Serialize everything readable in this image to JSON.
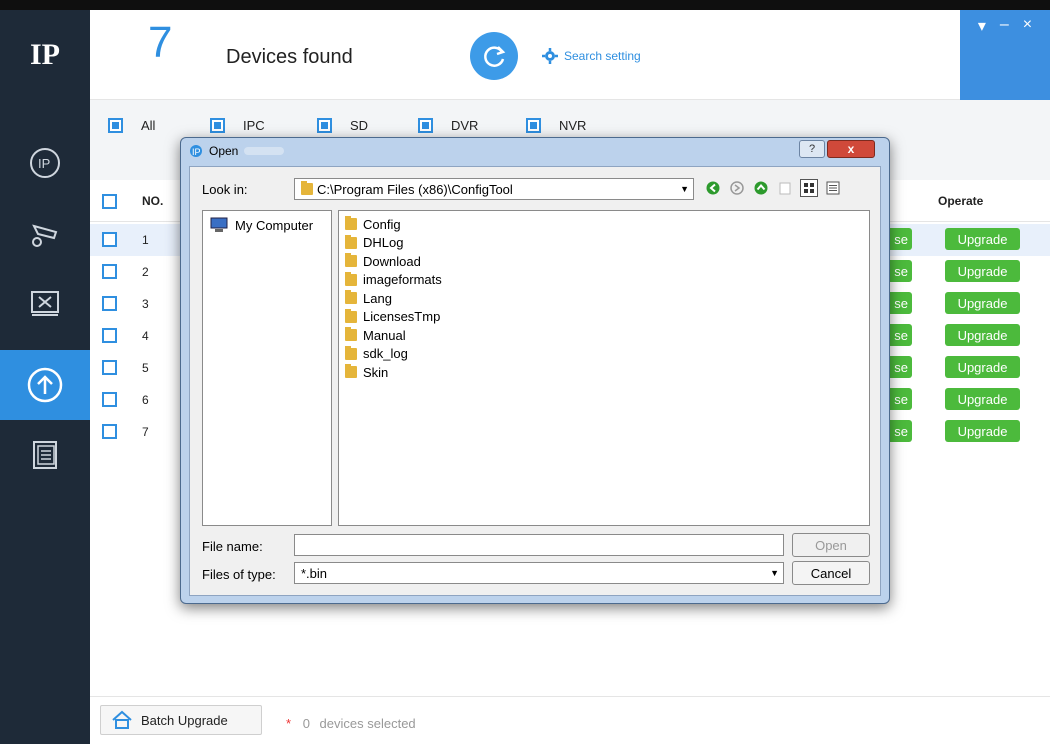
{
  "app": {
    "device_count": "7",
    "found_label": "Devices found",
    "search_setting": "Search setting",
    "window_controls": [
      "▾",
      "–",
      "×"
    ]
  },
  "sidebar": {
    "logo": "IP",
    "items": [
      {
        "name": "ip-icon"
      },
      {
        "name": "camera-settings-icon"
      },
      {
        "name": "tools-icon"
      },
      {
        "name": "upgrade-icon",
        "active": true
      },
      {
        "name": "document-list-icon"
      }
    ]
  },
  "filters": {
    "all": "All",
    "ipc": "IPC",
    "sd": "SD",
    "dvr": "DVR",
    "nvr": "NVR"
  },
  "table": {
    "col_no": "NO.",
    "col_operate": "Operate",
    "browse_partial": "se",
    "upgrade_label": "Upgrade",
    "rows": [
      "1",
      "2",
      "3",
      "4",
      "5",
      "6",
      "7"
    ]
  },
  "footer": {
    "batch_upgrade": "Batch Upgrade",
    "star": "*",
    "selected_count": "0",
    "selected_text": "devices selected"
  },
  "dialog": {
    "title": "Open",
    "help": "?",
    "close": "x",
    "look_in_label": "Look in:",
    "look_in_value": "C:\\Program Files (x86)\\ConfigTool",
    "places": [
      "My Computer"
    ],
    "folders": [
      "Config",
      "DHLog",
      "Download",
      "imageformats",
      "Lang",
      "LicensesTmp",
      "Manual",
      "sdk_log",
      "Skin"
    ],
    "file_name_label": "File name:",
    "file_name_value": "",
    "files_of_type_label": "Files of type:",
    "files_of_type_value": "*.bin",
    "open_button": "Open",
    "cancel_button": "Cancel"
  },
  "colors": {
    "accent": "#2f8fe0",
    "sidebar": "#1e2a38",
    "upgrade_green": "#4cba3c"
  }
}
